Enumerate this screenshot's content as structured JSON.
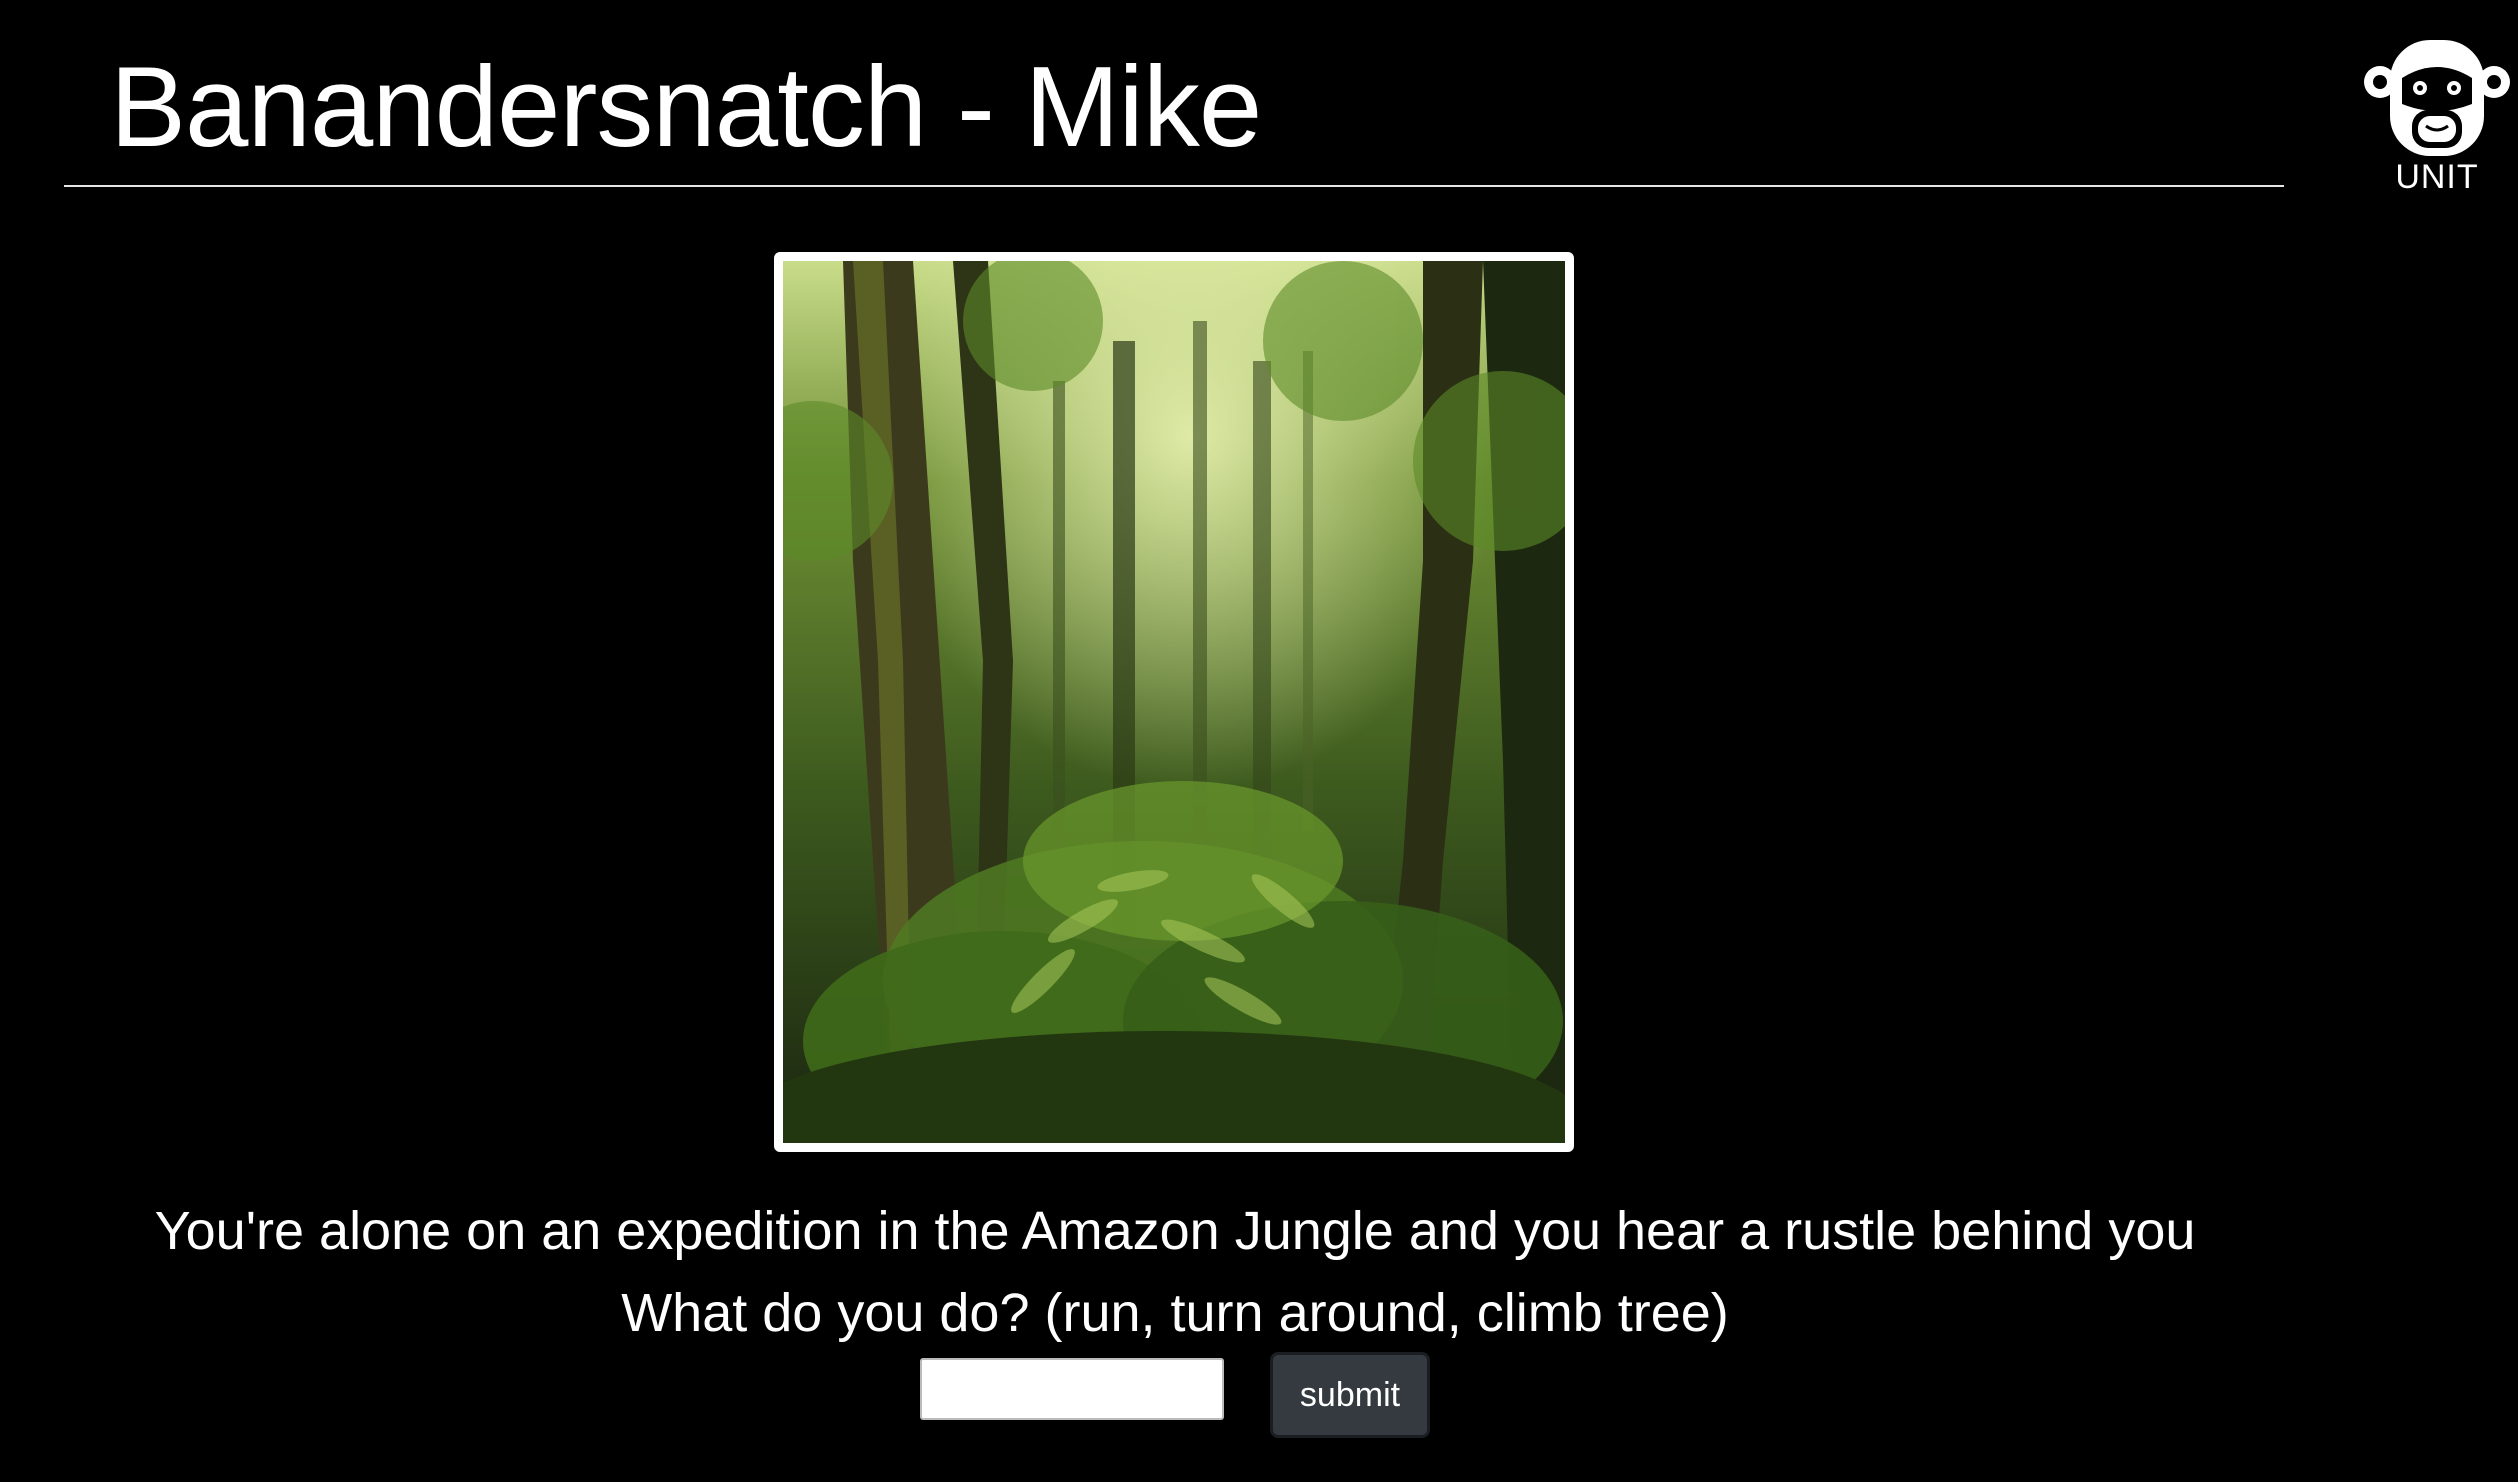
{
  "header": {
    "title": "Banandersnatch - Mike",
    "logo_text": "UNIT",
    "logo_icon": "monkey-face-icon"
  },
  "scene": {
    "image_subject": "dense green jungle with mossy trees and ferns",
    "story_text": "You're alone on an expedition in the Amazon Jungle and you hear a rustle behind you",
    "prompt_text": "What do you do? (run, turn around, climb tree)"
  },
  "form": {
    "input_value": "",
    "input_placeholder": "",
    "submit_label": "submit"
  },
  "colors": {
    "background": "#000000",
    "text": "#ffffff",
    "button": "#343a40",
    "jungle_dark": "#1f2e12",
    "jungle_light": "#a8c85a"
  }
}
